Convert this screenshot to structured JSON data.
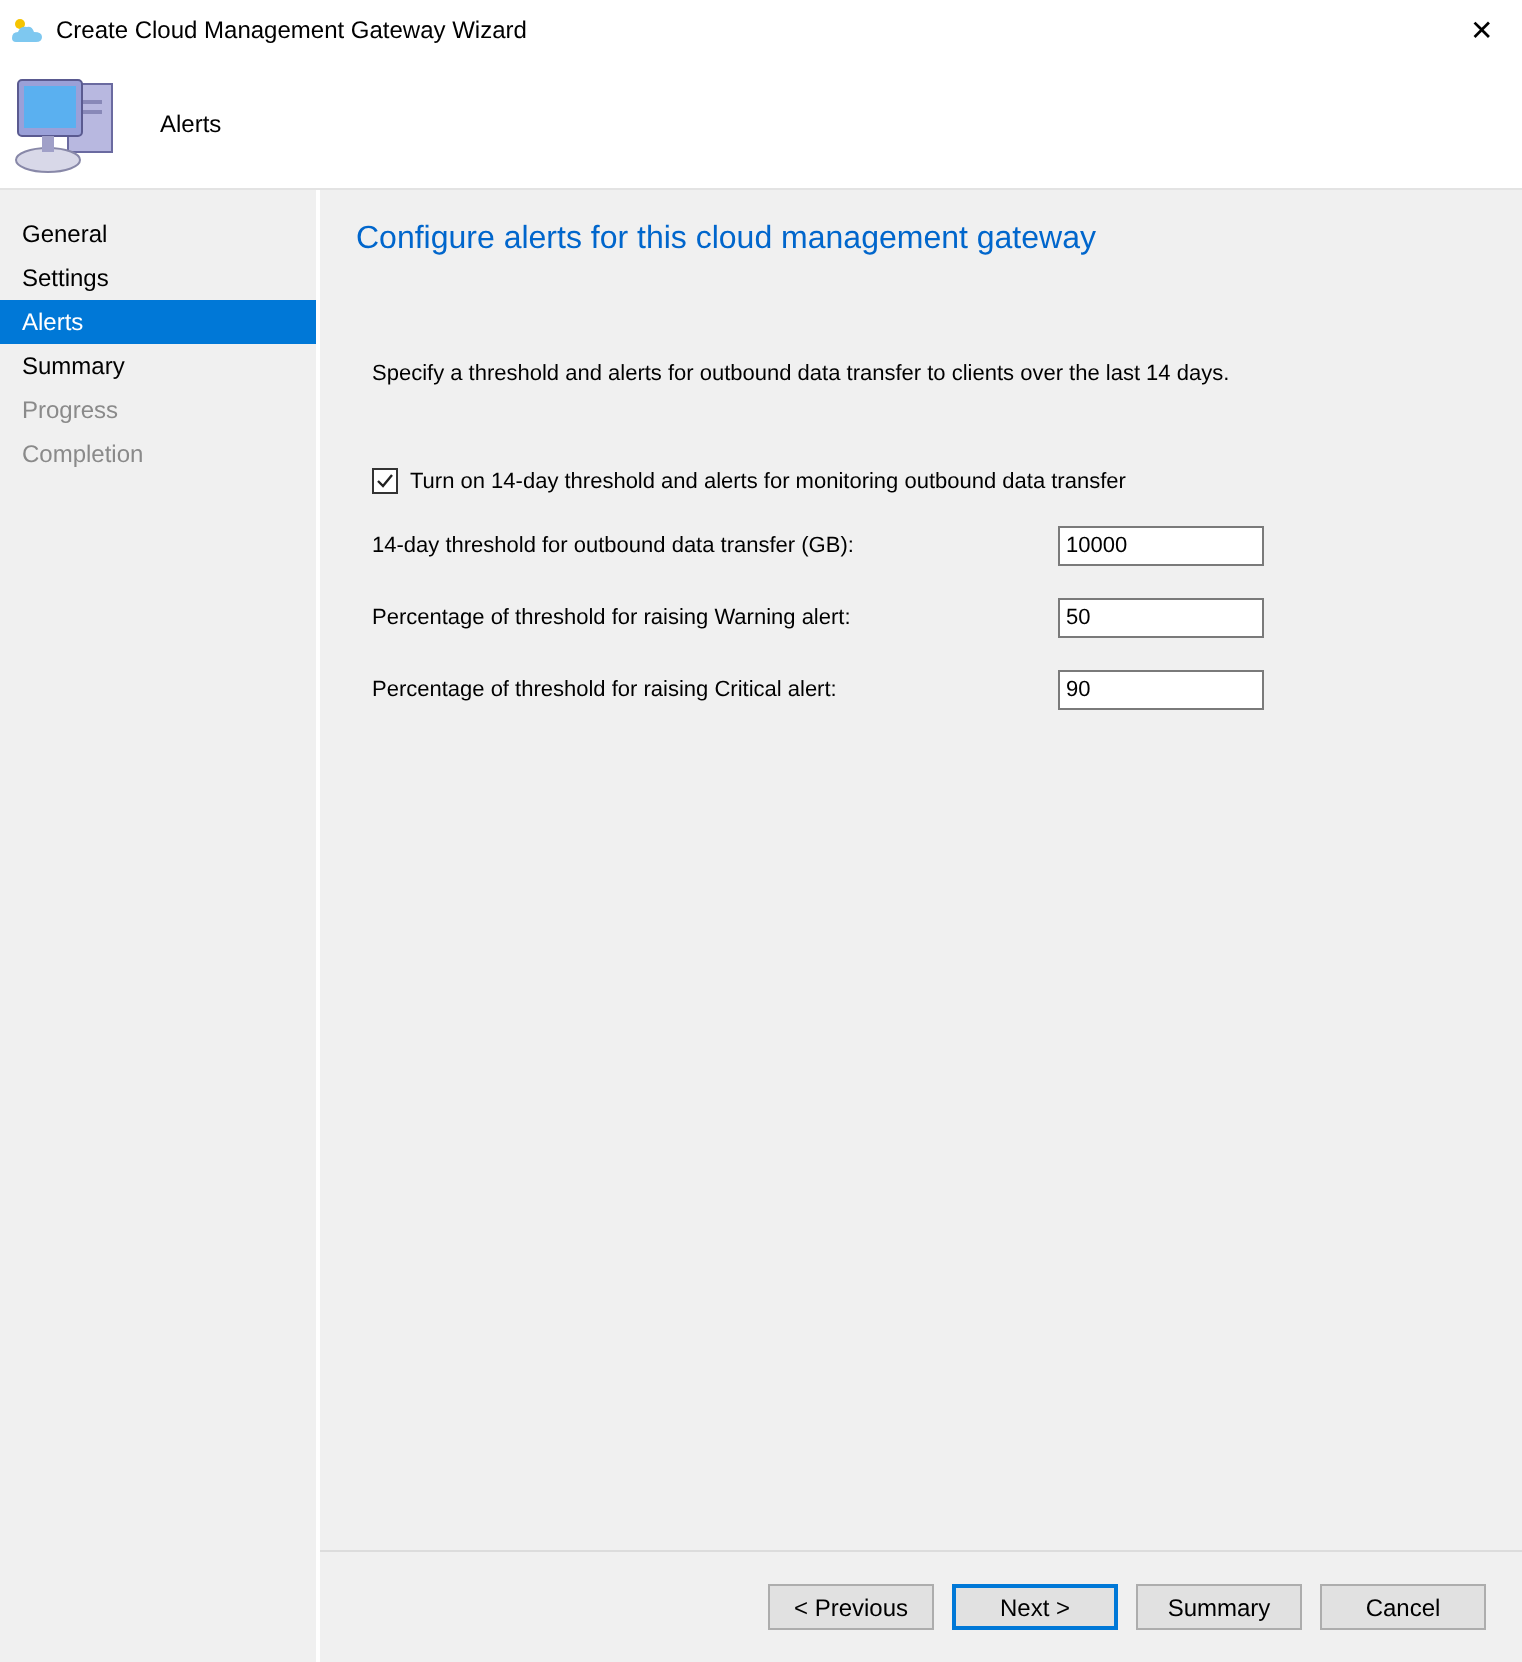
{
  "window": {
    "title": "Create Cloud Management Gateway Wizard",
    "close": "✕"
  },
  "header": {
    "title": "Alerts"
  },
  "sidebar": {
    "items": [
      {
        "label": "General",
        "selected": false,
        "disabled": false
      },
      {
        "label": "Settings",
        "selected": false,
        "disabled": false
      },
      {
        "label": "Alerts",
        "selected": true,
        "disabled": false
      },
      {
        "label": "Summary",
        "selected": false,
        "disabled": false
      },
      {
        "label": "Progress",
        "selected": false,
        "disabled": true
      },
      {
        "label": "Completion",
        "selected": false,
        "disabled": true
      }
    ]
  },
  "page": {
    "heading": "Configure alerts for this cloud management gateway",
    "description": "Specify a threshold and alerts for outbound data transfer to clients over the last 14 days.",
    "checkbox": {
      "label": "Turn on 14-day threshold and alerts for monitoring outbound data transfer",
      "checked": true
    },
    "fields": [
      {
        "label": "14-day threshold for outbound data transfer (GB):",
        "value": "10000"
      },
      {
        "label": "Percentage of threshold for raising Warning alert:",
        "value": "50"
      },
      {
        "label": "Percentage of threshold for raising Critical alert:",
        "value": "90"
      }
    ]
  },
  "buttons": [
    {
      "label": "< Previous",
      "focused": false
    },
    {
      "label": "Next >",
      "focused": true
    },
    {
      "label": "Summary",
      "focused": false
    },
    {
      "label": "Cancel",
      "focused": false
    }
  ]
}
